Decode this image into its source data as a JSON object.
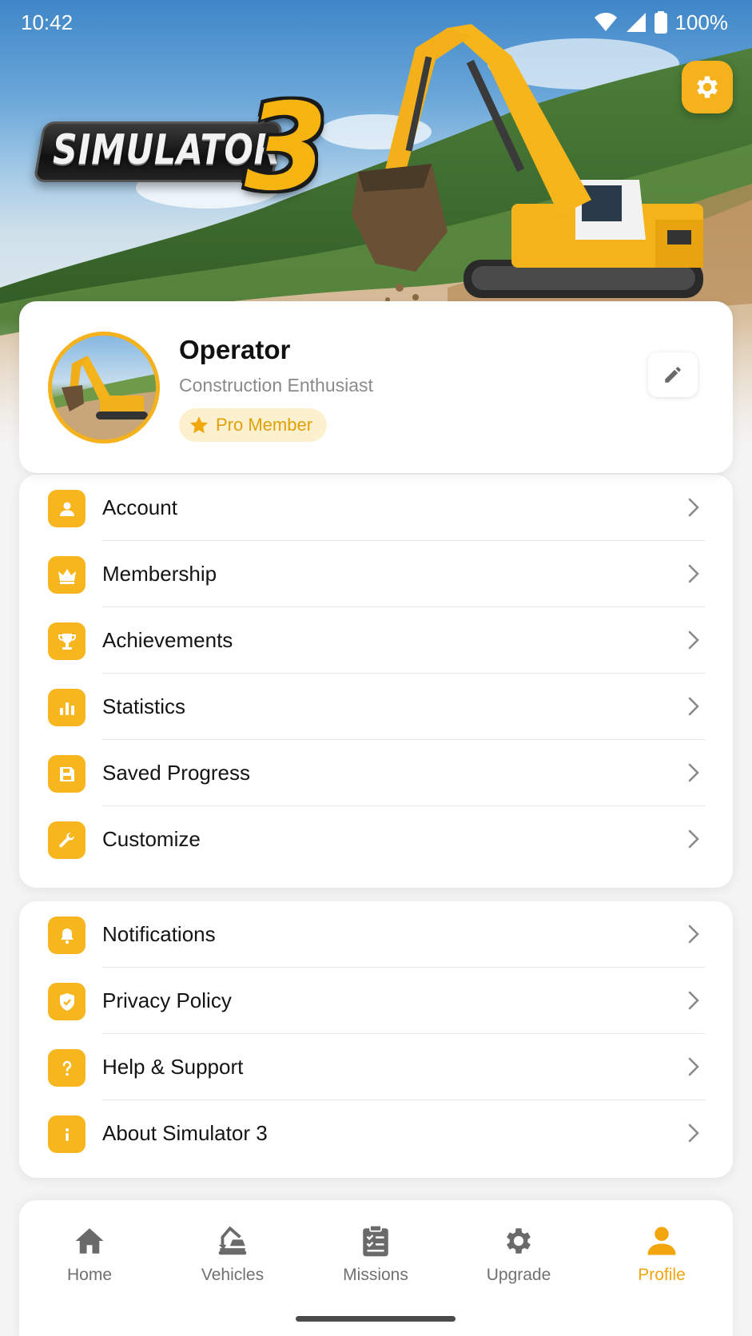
{
  "status_bar": {
    "time": "10:42",
    "battery": "100%"
  },
  "hero": {
    "logo_word": "SIMULATOR",
    "logo_number": "3"
  },
  "profile": {
    "name": "Operator",
    "subtitle": "Construction Enthusiast",
    "badge": "Pro Member"
  },
  "menu_primary": [
    {
      "label": "Account",
      "icon": "user-icon"
    },
    {
      "label": "Membership",
      "icon": "crown-icon"
    },
    {
      "label": "Achievements",
      "icon": "trophy-icon"
    },
    {
      "label": "Statistics",
      "icon": "bar-chart-icon"
    },
    {
      "label": "Saved Progress",
      "icon": "save-icon"
    },
    {
      "label": "Customize",
      "icon": "wrench-icon"
    }
  ],
  "menu_secondary": [
    {
      "label": "Notifications",
      "icon": "bell-icon"
    },
    {
      "label": "Privacy Policy",
      "icon": "shield-icon"
    },
    {
      "label": "Help & Support",
      "icon": "question-icon"
    },
    {
      "label": "About Simulator 3",
      "icon": "info-icon"
    }
  ],
  "bottom_nav": [
    {
      "label": "Home",
      "icon": "home-icon",
      "active": false
    },
    {
      "label": "Vehicles",
      "icon": "excavator-icon",
      "active": false
    },
    {
      "label": "Missions",
      "icon": "clipboard-icon",
      "active": false
    },
    {
      "label": "Upgrade",
      "icon": "gear-icon",
      "active": false
    },
    {
      "label": "Profile",
      "icon": "person-icon",
      "active": true
    }
  ],
  "colors": {
    "accent": "#f5b21c",
    "active_nav": "#f2a50c",
    "badge_bg": "#fdf0cf",
    "text_muted": "#8a8a8a"
  }
}
